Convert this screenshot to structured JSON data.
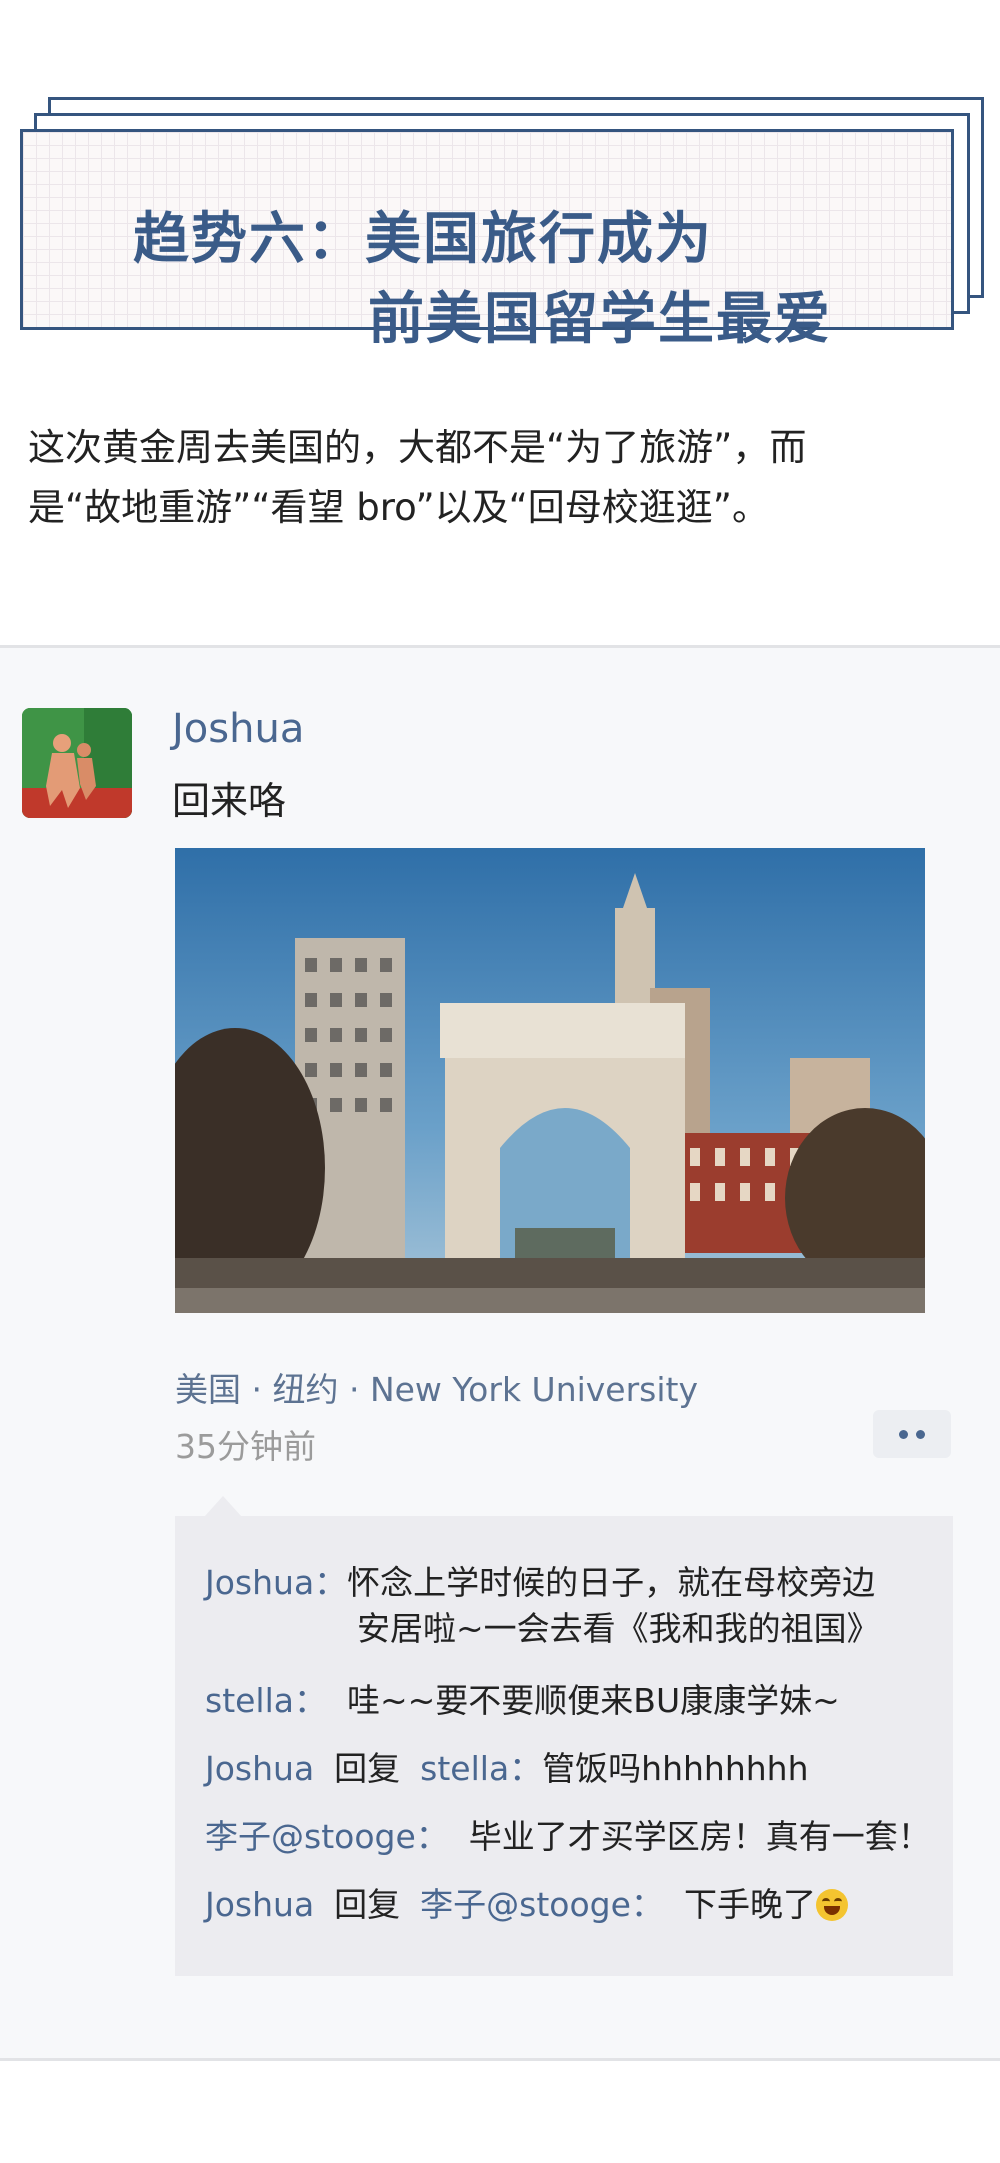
{
  "header": {
    "title_line1": "趋势六：美国旅行成为",
    "title_line2": "前美国留学生最爱"
  },
  "intro": {
    "line1": "这次黄金周去美国的，大都不是“为了旅游”，而",
    "line2": "是“故地重游”“看望 bro”以及“回母校逛逛”。"
  },
  "post": {
    "user_name": "Joshua",
    "text": "回来咯",
    "location": "美国 · 纽约 · New York University",
    "time": "35分钟前"
  },
  "comments": [
    {
      "author": "Joshua：",
      "text_line1": "怀念上学时候的日子，就在母校旁边",
      "text_line2": "安居啦~一会去看《我和我的祖国》"
    },
    {
      "author": "stella：",
      "text": "哇~~要不要顺便来BU康康学妹~"
    },
    {
      "author": "Joshua",
      "reply_word": "回复",
      "target": "stella：",
      "text": "管饭吗hhhhhhhh"
    },
    {
      "author": "李子@stooge：",
      "text": "毕业了才买学区房！真有一套！"
    },
    {
      "author": "Joshua",
      "reply_word": "回复",
      "target": "李子@stooge：",
      "text": "下手晚了"
    }
  ],
  "colors": {
    "title_blue": "#3a5b88",
    "name_blue": "#4a6790",
    "comment_bg": "#ececf0",
    "feed_bg": "#f7f8fa"
  }
}
